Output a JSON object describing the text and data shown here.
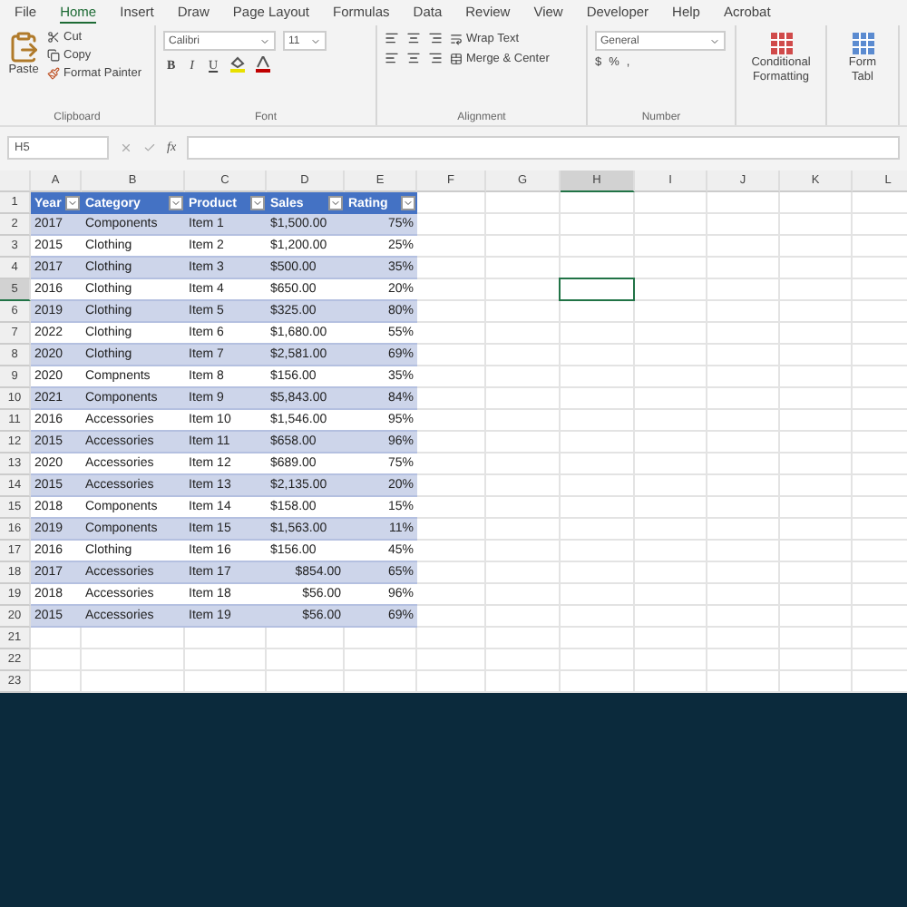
{
  "menu": [
    {
      "label": "File",
      "selected": false
    },
    {
      "label": "Home",
      "selected": true
    },
    {
      "label": "Insert",
      "selected": false
    },
    {
      "label": "Draw",
      "selected": false
    },
    {
      "label": "Page Layout",
      "selected": false
    },
    {
      "label": "Formulas",
      "selected": false
    },
    {
      "label": "Data",
      "selected": false
    },
    {
      "label": "Review",
      "selected": false
    },
    {
      "label": "View",
      "selected": false
    },
    {
      "label": "Developer",
      "selected": false
    },
    {
      "label": "Help",
      "selected": false
    },
    {
      "label": "Acrobat",
      "selected": false
    }
  ],
  "ribbon": {
    "clipboard": {
      "label": "Clipboard",
      "paste": "Paste",
      "cut": "Cut",
      "copy": "Copy",
      "format_painter": "Format Painter"
    },
    "font": {
      "label": "Font",
      "name": "Calibri",
      "size": "11",
      "bold": "B",
      "italic": "I",
      "underline": "U"
    },
    "alignment": {
      "label": "Alignment",
      "wrap": "Wrap Text",
      "merge": "Merge & Center"
    },
    "number": {
      "label": "Number",
      "format": "General",
      "currency": "$",
      "percent": "%",
      "comma": ","
    },
    "styles": [
      {
        "line1": "Conditional",
        "line2": "Formatting"
      },
      {
        "line1": "Form",
        "line2": "Tabl"
      }
    ]
  },
  "formula_bar": {
    "name_box": "H5",
    "fx": "fx"
  },
  "columns": [
    {
      "label": "A",
      "selected": false
    },
    {
      "label": "B",
      "selected": false
    },
    {
      "label": "C",
      "selected": false
    },
    {
      "label": "D",
      "selected": false
    },
    {
      "label": "E",
      "selected": false
    },
    {
      "label": "F",
      "selected": false
    },
    {
      "label": "G",
      "selected": false
    },
    {
      "label": "H",
      "selected": true
    },
    {
      "label": "I",
      "selected": false
    },
    {
      "label": "J",
      "selected": false
    },
    {
      "label": "K",
      "selected": false
    },
    {
      "label": "L",
      "selected": false
    }
  ],
  "row_numbers": [
    {
      "label": "1",
      "selected": false
    },
    {
      "label": "2",
      "selected": false
    },
    {
      "label": "3",
      "selected": false
    },
    {
      "label": "4",
      "selected": false
    },
    {
      "label": "5",
      "selected": true
    },
    {
      "label": "6",
      "selected": false
    },
    {
      "label": "7",
      "selected": false
    },
    {
      "label": "8",
      "selected": false
    },
    {
      "label": "9",
      "selected": false
    },
    {
      "label": "10",
      "selected": false
    },
    {
      "label": "11",
      "selected": false
    },
    {
      "label": "12",
      "selected": false
    },
    {
      "label": "13",
      "selected": false
    },
    {
      "label": "14",
      "selected": false
    },
    {
      "label": "15",
      "selected": false
    },
    {
      "label": "16",
      "selected": false
    },
    {
      "label": "17",
      "selected": false
    },
    {
      "label": "18",
      "selected": false
    },
    {
      "label": "19",
      "selected": false
    },
    {
      "label": "20",
      "selected": false
    },
    {
      "label": "21",
      "selected": false
    },
    {
      "label": "22",
      "selected": false
    },
    {
      "label": "23",
      "selected": false
    }
  ],
  "table": {
    "headers": [
      "Year",
      "Category",
      "Product",
      "Sales",
      "Rating"
    ],
    "rows": [
      {
        "year": "2017",
        "category": "Components",
        "product": "Item 1",
        "sales": "$1,500.00",
        "rating": "75%",
        "sales_right": false
      },
      {
        "year": "2015",
        "category": "Clothing",
        "product": "Item 2",
        "sales": "$1,200.00",
        "rating": "25%",
        "sales_right": false
      },
      {
        "year": "2017",
        "category": "Clothing",
        "product": "Item 3",
        "sales": "$500.00",
        "rating": "35%",
        "sales_right": false
      },
      {
        "year": "2016",
        "category": "Clothing",
        "product": "Item 4",
        "sales": "$650.00",
        "rating": "20%",
        "sales_right": false
      },
      {
        "year": "2019",
        "category": "Clothing",
        "product": "Item 5",
        "sales": "$325.00",
        "rating": "80%",
        "sales_right": false
      },
      {
        "year": "2022",
        "category": "Clothing",
        "product": "Item 6",
        "sales": "$1,680.00",
        "rating": "55%",
        "sales_right": false
      },
      {
        "year": "2020",
        "category": "Clothing",
        "product": "Item 7",
        "sales": "$2,581.00",
        "rating": "69%",
        "sales_right": false
      },
      {
        "year": "2020",
        "category": "Compnents",
        "product": "Item 8",
        "sales": "$156.00",
        "rating": "35%",
        "sales_right": false
      },
      {
        "year": "2021",
        "category": "Components",
        "product": "Item 9",
        "sales": "$5,843.00",
        "rating": "84%",
        "sales_right": false
      },
      {
        "year": "2016",
        "category": "Accessories",
        "product": "Item 10",
        "sales": "$1,546.00",
        "rating": "95%",
        "sales_right": false
      },
      {
        "year": "2015",
        "category": "Accessories",
        "product": "Item 11",
        "sales": "$658.00",
        "rating": "96%",
        "sales_right": false
      },
      {
        "year": "2020",
        "category": "Accessories",
        "product": "Item 12",
        "sales": "$689.00",
        "rating": "75%",
        "sales_right": false
      },
      {
        "year": "2015",
        "category": "Accessories",
        "product": "Item 13",
        "sales": "$2,135.00",
        "rating": "20%",
        "sales_right": false
      },
      {
        "year": "2018",
        "category": "Components",
        "product": "Item 14",
        "sales": "$158.00",
        "rating": "15%",
        "sales_right": false
      },
      {
        "year": "2019",
        "category": "Components",
        "product": "Item 15",
        "sales": "$1,563.00",
        "rating": "11%",
        "sales_right": false
      },
      {
        "year": "2016",
        "category": "Clothing",
        "product": "Item 16",
        "sales": "$156.00",
        "rating": "45%",
        "sales_right": false
      },
      {
        "year": "2017",
        "category": "Accessories",
        "product": "Item 17",
        "sales": "$854.00",
        "rating": "65%",
        "sales_right": true
      },
      {
        "year": "2018",
        "category": "Accessories",
        "product": "Item 18",
        "sales": "$56.00",
        "rating": "96%",
        "sales_right": true
      },
      {
        "year": "2015",
        "category": "Accessories",
        "product": "Item 19",
        "sales": "$56.00",
        "rating": "69%",
        "sales_right": true
      }
    ]
  }
}
